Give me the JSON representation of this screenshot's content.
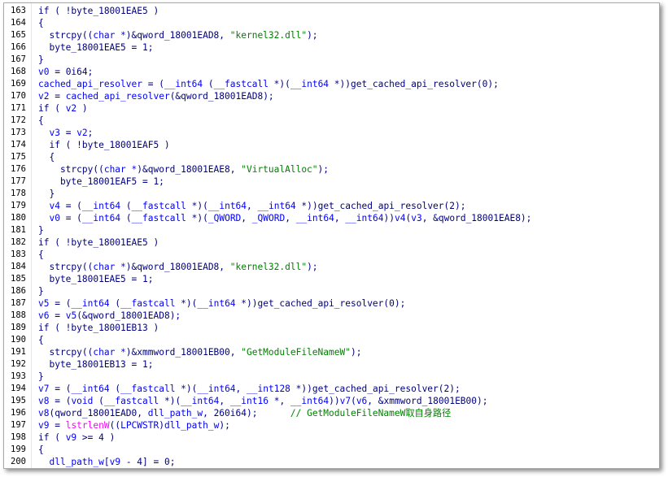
{
  "lines": [
    {
      "n": "163",
      "seg": [
        [
          "d",
          "if ( !byte_18001EAE5 )"
        ]
      ]
    },
    {
      "n": "164",
      "seg": [
        [
          "d",
          "{"
        ]
      ]
    },
    {
      "n": "165",
      "seg": [
        [
          "d",
          "  strcpy(("
        ],
        [
          "v",
          "char *"
        ],
        [
          "d",
          ")&qword_18001EAD8, "
        ],
        [
          "s",
          "\"kernel32.dll\""
        ],
        [
          "d",
          ");"
        ]
      ]
    },
    {
      "n": "166",
      "seg": [
        [
          "d",
          "  byte_18001EAE5 = 1;"
        ]
      ]
    },
    {
      "n": "167",
      "seg": [
        [
          "d",
          "}"
        ]
      ]
    },
    {
      "n": "168",
      "seg": [
        [
          "v",
          "v0"
        ],
        [
          "d",
          " = 0i64;"
        ]
      ]
    },
    {
      "n": "169",
      "seg": [
        [
          "v",
          "cached_api_resolver"
        ],
        [
          "d",
          " = ("
        ],
        [
          "v",
          "__int64"
        ],
        [
          "d",
          " ("
        ],
        [
          "v",
          "__fastcall"
        ],
        [
          "d",
          " *)("
        ],
        [
          "v",
          "__int64"
        ],
        [
          "d",
          " *))get_cached_api_resolver(0);"
        ]
      ]
    },
    {
      "n": "170",
      "seg": [
        [
          "v",
          "v2"
        ],
        [
          "d",
          " = "
        ],
        [
          "v",
          "cached_api_resolver"
        ],
        [
          "d",
          "(&qword_18001EAD8);"
        ]
      ]
    },
    {
      "n": "171",
      "seg": [
        [
          "d",
          "if ( "
        ],
        [
          "v",
          "v2"
        ],
        [
          "d",
          " )"
        ]
      ]
    },
    {
      "n": "172",
      "seg": [
        [
          "d",
          "{"
        ]
      ]
    },
    {
      "n": "173",
      "seg": [
        [
          "d",
          "  "
        ],
        [
          "v",
          "v3"
        ],
        [
          "d",
          " = "
        ],
        [
          "v",
          "v2"
        ],
        [
          "d",
          ";"
        ]
      ]
    },
    {
      "n": "174",
      "seg": [
        [
          "d",
          "  if ( !byte_18001EAF5 )"
        ]
      ]
    },
    {
      "n": "175",
      "seg": [
        [
          "d",
          "  {"
        ]
      ]
    },
    {
      "n": "176",
      "seg": [
        [
          "d",
          "    strcpy(("
        ],
        [
          "v",
          "char *"
        ],
        [
          "d",
          ")&qword_18001EAE8, "
        ],
        [
          "s",
          "\"VirtualAlloc\""
        ],
        [
          "d",
          ");"
        ]
      ]
    },
    {
      "n": "177",
      "seg": [
        [
          "d",
          "    byte_18001EAF5 = 1;"
        ]
      ]
    },
    {
      "n": "178",
      "seg": [
        [
          "d",
          "  }"
        ]
      ]
    },
    {
      "n": "179",
      "seg": [
        [
          "d",
          "  "
        ],
        [
          "v",
          "v4"
        ],
        [
          "d",
          " = ("
        ],
        [
          "v",
          "__int64"
        ],
        [
          "d",
          " ("
        ],
        [
          "v",
          "__fastcall"
        ],
        [
          "d",
          " *)("
        ],
        [
          "v",
          "__int64"
        ],
        [
          "d",
          ", "
        ],
        [
          "v",
          "__int64"
        ],
        [
          "d",
          " *))get_cached_api_resolver(2);"
        ]
      ]
    },
    {
      "n": "180",
      "seg": [
        [
          "d",
          "  "
        ],
        [
          "v",
          "v0"
        ],
        [
          "d",
          " = ("
        ],
        [
          "v",
          "__int64"
        ],
        [
          "d",
          " ("
        ],
        [
          "v",
          "__fastcall"
        ],
        [
          "d",
          " *)("
        ],
        [
          "v",
          "_QWORD"
        ],
        [
          "d",
          ", "
        ],
        [
          "v",
          "_QWORD"
        ],
        [
          "d",
          ", "
        ],
        [
          "v",
          "__int64"
        ],
        [
          "d",
          ", "
        ],
        [
          "v",
          "__int64"
        ],
        [
          "d",
          "))"
        ],
        [
          "v",
          "v4"
        ],
        [
          "d",
          "("
        ],
        [
          "v",
          "v3"
        ],
        [
          "d",
          ", &qword_18001EAE8);"
        ]
      ]
    },
    {
      "n": "181",
      "seg": [
        [
          "d",
          "}"
        ]
      ]
    },
    {
      "n": "182",
      "seg": [
        [
          "d",
          "if ( !byte_18001EAE5 )"
        ]
      ]
    },
    {
      "n": "183",
      "seg": [
        [
          "d",
          "{"
        ]
      ]
    },
    {
      "n": "184",
      "seg": [
        [
          "d",
          "  strcpy(("
        ],
        [
          "v",
          "char *"
        ],
        [
          "d",
          ")&qword_18001EAD8, "
        ],
        [
          "s",
          "\"kernel32.dll\""
        ],
        [
          "d",
          ");"
        ]
      ]
    },
    {
      "n": "185",
      "seg": [
        [
          "d",
          "  byte_18001EAE5 = 1;"
        ]
      ]
    },
    {
      "n": "186",
      "seg": [
        [
          "d",
          "}"
        ]
      ]
    },
    {
      "n": "187",
      "seg": [
        [
          "v",
          "v5"
        ],
        [
          "d",
          " = ("
        ],
        [
          "v",
          "__int64"
        ],
        [
          "d",
          " ("
        ],
        [
          "v",
          "__fastcall"
        ],
        [
          "d",
          " *)("
        ],
        [
          "v",
          "__int64"
        ],
        [
          "d",
          " *))get_cached_api_resolver(0);"
        ]
      ]
    },
    {
      "n": "188",
      "seg": [
        [
          "v",
          "v6"
        ],
        [
          "d",
          " = "
        ],
        [
          "v",
          "v5"
        ],
        [
          "d",
          "(&qword_18001EAD8);"
        ]
      ]
    },
    {
      "n": "189",
      "seg": [
        [
          "d",
          "if ( !byte_18001EB13 )"
        ]
      ]
    },
    {
      "n": "190",
      "seg": [
        [
          "d",
          "{"
        ]
      ]
    },
    {
      "n": "191",
      "seg": [
        [
          "d",
          "  strcpy(("
        ],
        [
          "v",
          "char *"
        ],
        [
          "d",
          ")&xmmword_18001EB00, "
        ],
        [
          "s",
          "\"GetModuleFileNameW\""
        ],
        [
          "d",
          ");"
        ]
      ]
    },
    {
      "n": "192",
      "seg": [
        [
          "d",
          "  byte_18001EB13 = 1;"
        ]
      ]
    },
    {
      "n": "193",
      "seg": [
        [
          "d",
          "}"
        ]
      ]
    },
    {
      "n": "194",
      "seg": [
        [
          "v",
          "v7"
        ],
        [
          "d",
          " = ("
        ],
        [
          "v",
          "__int64"
        ],
        [
          "d",
          " ("
        ],
        [
          "v",
          "__fastcall"
        ],
        [
          "d",
          " *)("
        ],
        [
          "v",
          "__int64"
        ],
        [
          "d",
          ", "
        ],
        [
          "v",
          "__int128"
        ],
        [
          "d",
          " *))get_cached_api_resolver(2);"
        ]
      ]
    },
    {
      "n": "195",
      "seg": [
        [
          "v",
          "v8"
        ],
        [
          "d",
          " = ("
        ],
        [
          "v",
          "void"
        ],
        [
          "d",
          " ("
        ],
        [
          "v",
          "__fastcall"
        ],
        [
          "d",
          " *)("
        ],
        [
          "v",
          "__int64"
        ],
        [
          "d",
          ", "
        ],
        [
          "v",
          "__int16"
        ],
        [
          "d",
          " *, "
        ],
        [
          "v",
          "__int64"
        ],
        [
          "d",
          "))"
        ],
        [
          "v",
          "v7"
        ],
        [
          "d",
          "("
        ],
        [
          "v",
          "v6"
        ],
        [
          "d",
          ", &xmmword_18001EB00);"
        ]
      ]
    },
    {
      "n": "196",
      "seg": [
        [
          "v",
          "v8"
        ],
        [
          "d",
          "(qword_18001EAD0, "
        ],
        [
          "v",
          "dll_path_w"
        ],
        [
          "d",
          ", 260i64);      "
        ],
        [
          "c",
          "// GetModuleFileNameW取自身路径"
        ]
      ]
    },
    {
      "n": "197",
      "seg": [
        [
          "v",
          "v9"
        ],
        [
          "d",
          " = "
        ],
        [
          "m",
          "lstrlenW"
        ],
        [
          "d",
          "(("
        ],
        [
          "v",
          "LPCWSTR"
        ],
        [
          "d",
          ")"
        ],
        [
          "v",
          "dll_path_w"
        ],
        [
          "d",
          ");"
        ]
      ]
    },
    {
      "n": "198",
      "seg": [
        [
          "d",
          "if ( "
        ],
        [
          "v",
          "v9"
        ],
        [
          "d",
          " >= 4 )"
        ]
      ]
    },
    {
      "n": "199",
      "seg": [
        [
          "d",
          "{"
        ]
      ]
    },
    {
      "n": "200",
      "seg": [
        [
          "d",
          "  "
        ],
        [
          "v",
          "dll_path_w"
        ],
        [
          "d",
          "["
        ],
        [
          "v",
          "v9"
        ],
        [
          "d",
          " - 4] = 0;"
        ]
      ]
    }
  ]
}
